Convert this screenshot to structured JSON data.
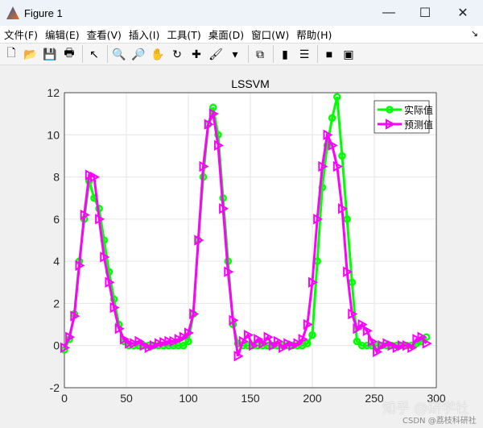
{
  "window": {
    "title": "Figure 1",
    "minimize": "—",
    "maximize": "☐",
    "close": "✕"
  },
  "menu": [
    "文件(F)",
    "编辑(E)",
    "查看(V)",
    "插入(I)",
    "工具(T)",
    "桌面(D)",
    "窗口(W)",
    "帮助(H)"
  ],
  "menu_dock": "↘",
  "toolbar": [
    {
      "name": "new-figure-icon",
      "glyph": "🗋"
    },
    {
      "name": "open-icon",
      "glyph": "📂"
    },
    {
      "name": "save-icon",
      "glyph": "💾"
    },
    {
      "name": "print-icon",
      "glyph": "🖶"
    },
    {
      "sep": true
    },
    {
      "name": "pointer-icon",
      "glyph": "↖"
    },
    {
      "sep": true
    },
    {
      "name": "zoom-in-icon",
      "glyph": "🔍"
    },
    {
      "name": "zoom-out-icon",
      "glyph": "🔎"
    },
    {
      "name": "pan-icon",
      "glyph": "✋"
    },
    {
      "name": "rotate-icon",
      "glyph": "↻"
    },
    {
      "name": "data-cursor-icon",
      "glyph": "✚"
    },
    {
      "name": "brush-icon",
      "glyph": "🖌"
    },
    {
      "name": "brush-dropdown-icon",
      "glyph": "▾"
    },
    {
      "sep": true
    },
    {
      "name": "link-plot-icon",
      "glyph": "⧉"
    },
    {
      "sep": true
    },
    {
      "name": "colorbar-icon",
      "glyph": "▮"
    },
    {
      "name": "legend-icon",
      "glyph": "☰"
    },
    {
      "sep": true
    },
    {
      "name": "hide-plot-tools-icon",
      "glyph": "■"
    },
    {
      "name": "show-plot-tools-icon",
      "glyph": "▣"
    }
  ],
  "colors": {
    "actual": "#00ff00",
    "predicted": "#ff00ff"
  },
  "chart_data": {
    "type": "line",
    "title": "LSSVM",
    "xlabel": "",
    "ylabel": "",
    "xlim": [
      0,
      300
    ],
    "ylim": [
      -2,
      12
    ],
    "xticks": [
      "0",
      "50",
      "100",
      "150",
      "200",
      "250",
      "300"
    ],
    "yticks": [
      "-2",
      "0",
      "2",
      "4",
      "6",
      "8",
      "10",
      "12"
    ],
    "grid": true,
    "legend_position": "top-right",
    "x": [
      0,
      4,
      8,
      12,
      16,
      20,
      24,
      28,
      32,
      36,
      40,
      44,
      48,
      52,
      56,
      60,
      64,
      68,
      72,
      76,
      80,
      84,
      88,
      92,
      96,
      100,
      104,
      108,
      112,
      116,
      120,
      124,
      128,
      132,
      136,
      140,
      144,
      148,
      152,
      156,
      160,
      164,
      168,
      172,
      176,
      180,
      184,
      188,
      192,
      196,
      200,
      204,
      208,
      212,
      216,
      220,
      224,
      228,
      232,
      236,
      240,
      244,
      248,
      252,
      256,
      260,
      264,
      268,
      272,
      276,
      280,
      284,
      288,
      292
    ],
    "series": [
      {
        "name": "实际值",
        "marker": "circle",
        "values": [
          -0.2,
          0.3,
          1.5,
          4,
          6,
          7.8,
          7,
          6.5,
          5,
          3.5,
          2.2,
          1,
          0.2,
          0,
          0,
          0,
          0,
          0,
          0,
          0,
          0,
          0,
          0,
          0,
          0,
          0.2,
          1.5,
          5,
          8,
          10.5,
          11.3,
          10,
          7,
          4,
          1,
          0.1,
          0,
          0,
          0,
          0,
          0,
          0,
          0,
          0,
          0,
          0,
          0,
          0,
          0,
          0.1,
          0.5,
          4,
          7.5,
          9.5,
          10.8,
          11.8,
          9,
          6,
          3,
          0.2,
          0,
          0,
          0,
          0,
          0,
          0,
          0,
          0,
          0,
          0,
          0,
          0.1,
          0.2,
          0.4
        ]
      },
      {
        "name": "预测值",
        "marker": "triangle-right",
        "values": [
          -0.1,
          0.4,
          1.4,
          3.8,
          6.2,
          8.1,
          8,
          6,
          4.2,
          3,
          1.8,
          0.8,
          0.3,
          0.1,
          0.1,
          0.2,
          0,
          -0.1,
          0,
          0.1,
          0.15,
          0.2,
          0.2,
          0.3,
          0.4,
          0.6,
          1.5,
          5,
          8.5,
          10.5,
          11,
          9.5,
          6.5,
          3.5,
          1.2,
          -0.5,
          0.2,
          0.5,
          0,
          0.3,
          0.1,
          0.4,
          0,
          0.2,
          -0.1,
          0.1,
          0,
          0.1,
          0.3,
          1,
          3,
          6,
          8.5,
          10,
          9.5,
          8.5,
          6.5,
          3.5,
          1.5,
          0.8,
          1,
          0.7,
          0.2,
          -0.3,
          0,
          0.1,
          0,
          -0.1,
          0,
          0,
          -0.1,
          0.3,
          0.4,
          0.1
        ]
      }
    ]
  },
  "watermark": {
    "line1": "知乎 @研学社",
    "line2": "CSDN @荔枝科研社"
  }
}
